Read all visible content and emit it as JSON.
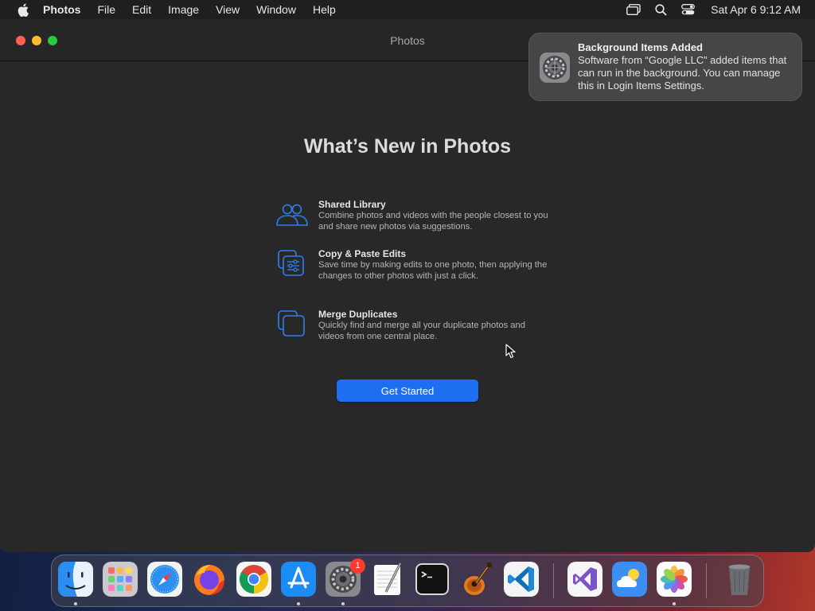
{
  "menubar": {
    "app_name": "Photos",
    "items": [
      "File",
      "Edit",
      "Image",
      "View",
      "Window",
      "Help"
    ],
    "clock": "Sat Apr 6  9:12 AM",
    "icons": [
      "apple-icon",
      "screen-mirroring-icon",
      "spotlight-search-icon",
      "control-center-icon"
    ]
  },
  "window": {
    "title": "Photos",
    "heading": "What’s New in Photos",
    "features": [
      {
        "icon": "people-icon",
        "title": "Shared Library",
        "description": "Combine photos and videos with the people closest to you and share new photos via suggestions."
      },
      {
        "icon": "copy-edits-icon",
        "title": "Copy & Paste Edits",
        "description": "Save time by making edits to one photo, then applying the changes to other photos with just a click."
      },
      {
        "icon": "duplicates-icon",
        "title": "Merge Duplicates",
        "description": "Quickly find and merge all your duplicate photos and videos from one central place."
      }
    ],
    "button_label": "Get Started",
    "accent_color": "#1e6ff0"
  },
  "notification": {
    "icon": "system-settings-icon",
    "title": "Background Items Added",
    "body": "Software from “Google LLC” added items that can run in the background. You can manage this in Login Items Settings."
  },
  "dock": {
    "apps": [
      "Finder",
      "Launchpad",
      "Safari",
      "Firefox",
      "Google Chrome",
      "App Store",
      "System Settings",
      "TextEdit",
      "Terminal",
      "GarageBand",
      "Visual Studio Code",
      "Visual Studio",
      "Weather",
      "Photos",
      "Trash"
    ],
    "system_settings_badge": "1"
  }
}
